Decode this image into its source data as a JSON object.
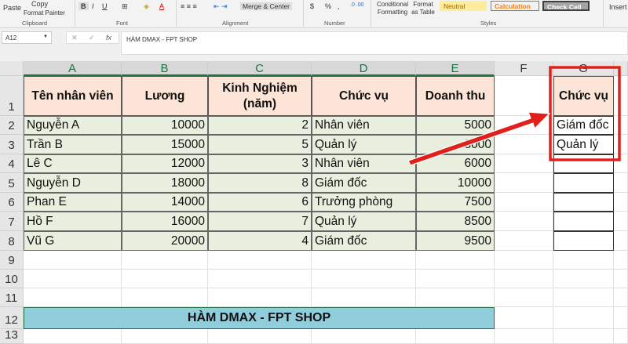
{
  "ribbon": {
    "paste": "Paste",
    "copy": "Copy",
    "format_painter": "Format Painter",
    "clipboard": "Clipboard",
    "font": "Font",
    "bold": "B",
    "italic": "I",
    "underline": "U",
    "alignment": "Alignment",
    "merge_center": "Merge & Center",
    "currency": "$",
    "percent": "%",
    "comma": ",",
    "number": "Number",
    "conditional_formatting": "Conditional Formatting",
    "format_as_table": "Format as Table",
    "neutral": "Neutral",
    "calculation": "Calculation",
    "check_cell": "Check Cell",
    "styles": "Styles",
    "insert": "Insert"
  },
  "formula_bar": {
    "name_box": "A12",
    "fx": "fx",
    "value": "HÀM DMAX - FPT SHOP"
  },
  "columns": [
    "A",
    "B",
    "C",
    "D",
    "E",
    "F",
    "G"
  ],
  "rows": [
    "1",
    "2",
    "3",
    "4",
    "5",
    "6",
    "7",
    "8",
    "9",
    "10",
    "11",
    "12",
    "13"
  ],
  "headers": [
    "Tên nhân viên",
    "Lương",
    "Kinh Nghiệm (năm)",
    "Chức vụ",
    "Doanh thu"
  ],
  "data": [
    [
      "Nguyễn A",
      "10000",
      "2",
      "Nhân viên",
      "5000"
    ],
    [
      "Trần B",
      "15000",
      "5",
      "Quản lý",
      "8000"
    ],
    [
      "Lê C",
      "12000",
      "3",
      "Nhân viên",
      "6000"
    ],
    [
      "Nguyễn D",
      "18000",
      "8",
      "Giám đốc",
      "10000"
    ],
    [
      "Phan E",
      "14000",
      "6",
      "Trưởng phòng",
      "7500"
    ],
    [
      "Hồ F",
      "16000",
      "7",
      "Quản lý",
      "8500"
    ],
    [
      "Vũ G",
      "20000",
      "4",
      "Giám đốc",
      "9500"
    ]
  ],
  "criteria": {
    "header": "Chức vụ",
    "values": [
      "Giám đốc",
      "Quản lý"
    ]
  },
  "banner": "HÀM DMAX - FPT SHOP",
  "colors": {
    "accent": "#217346",
    "header_fill": "#fce4d6",
    "data_fill": "#e9efdf",
    "banner_fill": "#92cddc",
    "highlight": "#e0201b"
  }
}
